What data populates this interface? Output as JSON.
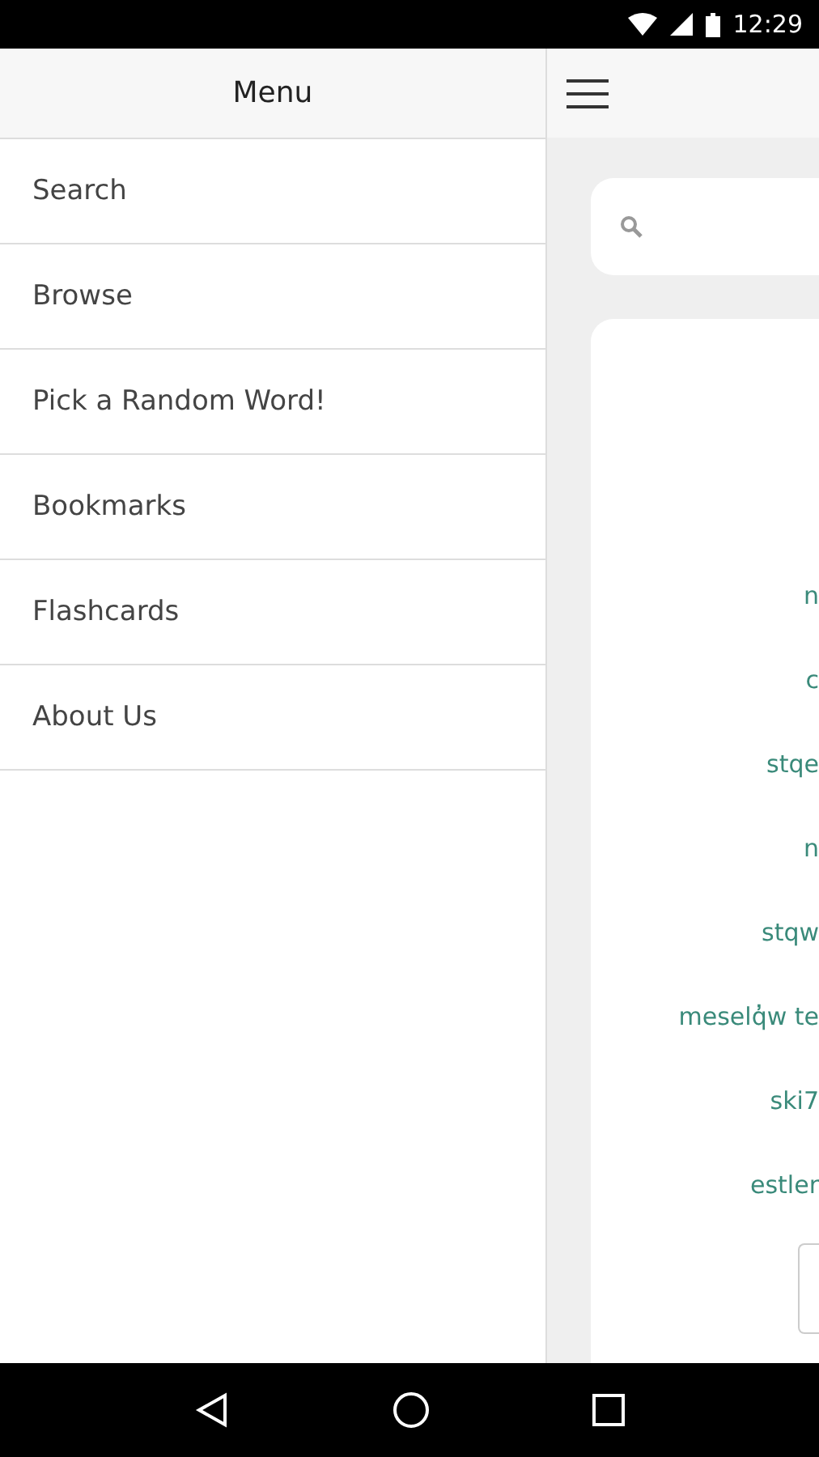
{
  "status_bar": {
    "time": "12:29"
  },
  "drawer": {
    "title": "Menu",
    "items": [
      {
        "label": "Search"
      },
      {
        "label": "Browse"
      },
      {
        "label": "Pick a Random Word!"
      },
      {
        "label": "Bookmarks"
      },
      {
        "label": "Flashcards"
      },
      {
        "label": "About Us"
      }
    ]
  },
  "content": {
    "words": [
      "n",
      "c",
      "stqe",
      "n",
      "stqw",
      "meselq̓w te",
      "ski7",
      "estler"
    ]
  }
}
